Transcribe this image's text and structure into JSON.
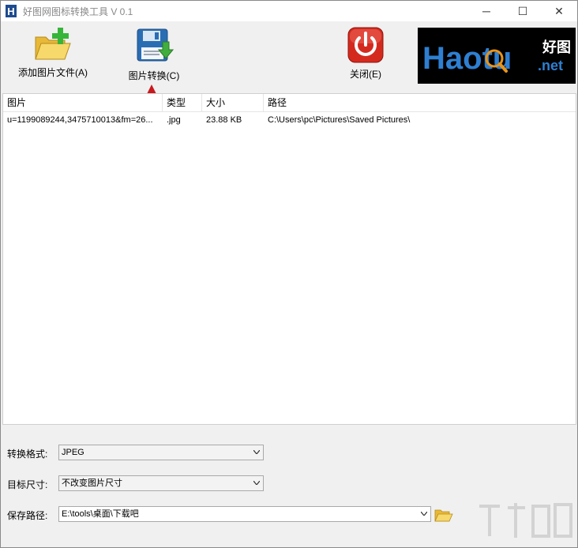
{
  "window": {
    "title": "好图网图标转换工具 V 0.1",
    "app_icon_letter": "H",
    "minimize": "─",
    "maximize": "☐",
    "close": "✕"
  },
  "toolbar": {
    "add_label": "添加图片文件(A)",
    "convert_label": "图片转换(C)",
    "close_label": "关闭(E)"
  },
  "logo": {
    "text_main": "Haotu",
    "text_cn": "好图",
    "text_net": ".net"
  },
  "list": {
    "columns": [
      "图片",
      "类型",
      "大小",
      "路径"
    ],
    "rows": [
      {
        "name": "u=1199089244,3475710013&fm=26...",
        "type": ".jpg",
        "size": "23.88 KB",
        "path": "C:\\Users\\pc\\Pictures\\Saved Pictures\\"
      }
    ]
  },
  "form": {
    "format_label": "转换格式:",
    "format_value": "JPEG",
    "size_label": "目标尺寸:",
    "size_value": "不改变图片尺寸",
    "path_label": "保存路径:",
    "path_value": "E:\\tools\\桌面\\下载吧"
  },
  "colors": {
    "arrow": "#c8191f",
    "logo_blue": "#2e7fd1",
    "logo_bg": "#000000"
  }
}
